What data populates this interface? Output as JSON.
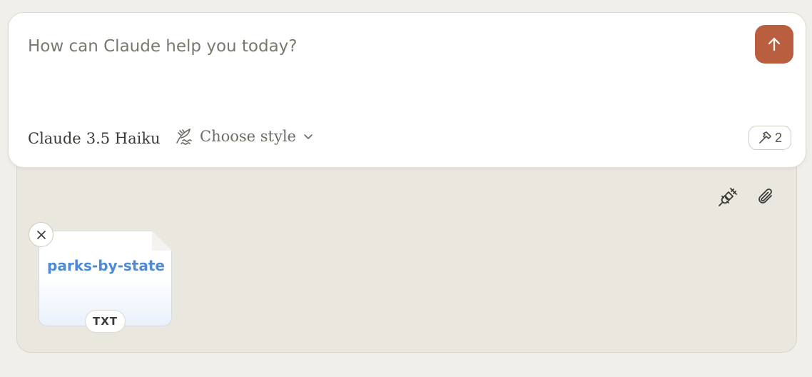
{
  "composer": {
    "placeholder": "How can Claude help you today?",
    "send_icon": "arrow-up-icon",
    "model": {
      "brand": "Claude",
      "version": "3.5 Haiku"
    },
    "style": {
      "label": "Choose style",
      "icon": "pen-style-icon"
    },
    "tools": {
      "icon": "hammer-icon",
      "count": "2"
    }
  },
  "tray": {
    "actions": [
      {
        "icon": "plug-icon"
      },
      {
        "icon": "paperclip-icon"
      }
    ],
    "attachment": {
      "name": "parks-by-state",
      "type": "TXT",
      "remove_icon": "close-icon"
    }
  },
  "colors": {
    "accent": "#b95f3f",
    "page_background": "#f1efe9",
    "tray_background": "#eae7df",
    "file_name": "#4f8ad6"
  }
}
